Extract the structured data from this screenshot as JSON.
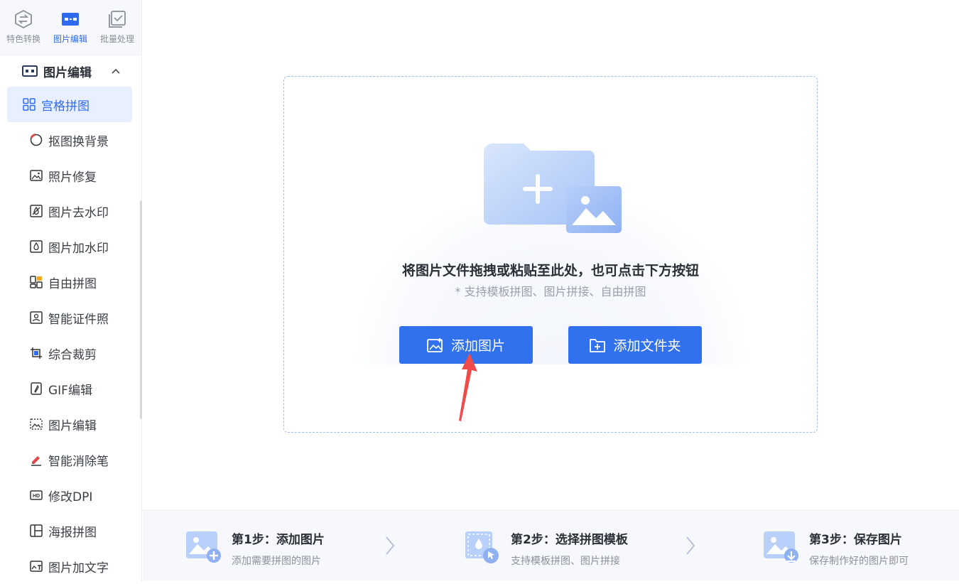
{
  "topnav": [
    {
      "label": "特色转换",
      "icon": "swap-icon"
    },
    {
      "label": "图片编辑",
      "icon": "image-edit-icon",
      "active": true
    },
    {
      "label": "批量处理",
      "icon": "batch-icon"
    }
  ],
  "section": {
    "title": "图片编辑"
  },
  "menu": [
    {
      "label": "宫格拼图",
      "icon": "grid-icon",
      "active": true
    },
    {
      "label": "抠图换背景",
      "icon": "cutout-icon"
    },
    {
      "label": "照片修复",
      "icon": "photo-repair-icon"
    },
    {
      "label": "图片去水印",
      "icon": "remove-watermark-icon"
    },
    {
      "label": "图片加水印",
      "icon": "add-watermark-icon"
    },
    {
      "label": "自由拼图",
      "icon": "free-collage-icon"
    },
    {
      "label": "智能证件照",
      "icon": "id-photo-icon"
    },
    {
      "label": "综合裁剪",
      "icon": "crop-icon"
    },
    {
      "label": "GIF编辑",
      "icon": "gif-icon"
    },
    {
      "label": "图片编辑",
      "icon": "image-editor-icon"
    },
    {
      "label": "智能消除笔",
      "icon": "eraser-pen-icon"
    },
    {
      "label": "修改DPI",
      "icon": "hd-icon"
    },
    {
      "label": "海报拼图",
      "icon": "poster-icon"
    },
    {
      "label": "图片加文字",
      "icon": "image-text-icon"
    }
  ],
  "drop": {
    "headline": "将图片文件拖拽或粘贴至此处，也可点击下方按钮",
    "sub": "* 支持模板拼图、图片拼接、自由拼图",
    "add_image": "添加图片",
    "add_folder": "添加文件夹"
  },
  "steps": [
    {
      "title": "第1步：添加图片",
      "desc": "添加需要拼图的图片"
    },
    {
      "title": "第2步：选择拼图模板",
      "desc": "支持模板拼图、图片拼接"
    },
    {
      "title": "第3步：保存图片",
      "desc": "保存制作好的图片即可"
    }
  ],
  "colors": {
    "accent": "#3171ee",
    "active_bg": "#e8f0ff",
    "arrow": "#f04b4b"
  }
}
